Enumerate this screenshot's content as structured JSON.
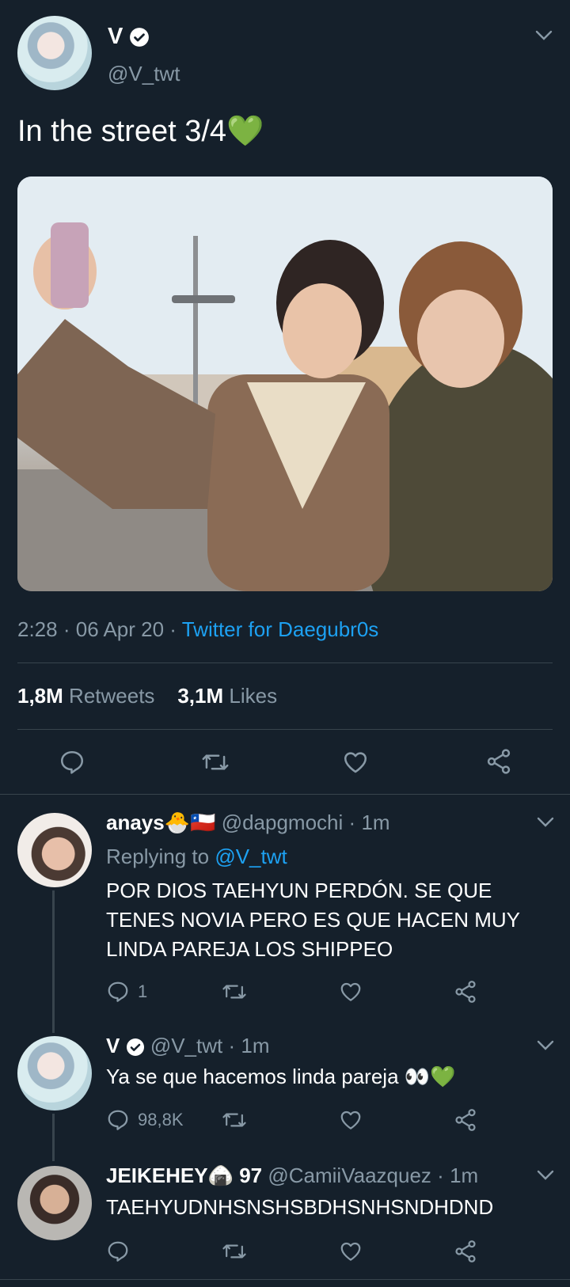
{
  "tweet": {
    "author_name": "V",
    "author_handle": "@V_twt",
    "text": "In the street 3/4💚",
    "time": "2:28",
    "sep1": "·",
    "date": "06 Apr 20",
    "sep2": "·",
    "source": "Twitter for Daegubr0s",
    "retweets_count": "1,8M",
    "retweets_label": "Retweets",
    "likes_count": "3,1M",
    "likes_label": "Likes"
  },
  "replies": [
    {
      "name": "anays🐣🇨🇱",
      "handle": "@dapgmochi",
      "sep": "·",
      "time": "1m",
      "replying_prefix": "Replying to",
      "replying_to": "@V_twt",
      "text_lines": [
        "POR DIOS TAEHYUN PERDÓN. SE QUE",
        "TENES NOVIA PERO ES QUE HACEN MUY",
        "LINDA PAREJA LOS SHIPPEO"
      ],
      "reply_count": "1"
    },
    {
      "name": "V",
      "handle": "@V_twt",
      "sep": "·",
      "time": "1m",
      "text": "Ya se que hacemos linda pareja 👀💚",
      "reply_count": "98,8K"
    },
    {
      "name": "JEIKEHEY🍙 97",
      "handle": "@CamiiVaazquez",
      "sep": "·",
      "time": "1m",
      "text": "TAEHYUDNHSNSHSBDHSNHSNDHDND"
    }
  ],
  "colors": {
    "background": "#15202b",
    "muted": "#8899a6",
    "link": "#1da1f2",
    "divider": "#38444d"
  },
  "icons": [
    "chevron-down-icon",
    "verified-badge-icon",
    "reply-icon",
    "retweet-icon",
    "like-icon",
    "share-icon"
  ]
}
